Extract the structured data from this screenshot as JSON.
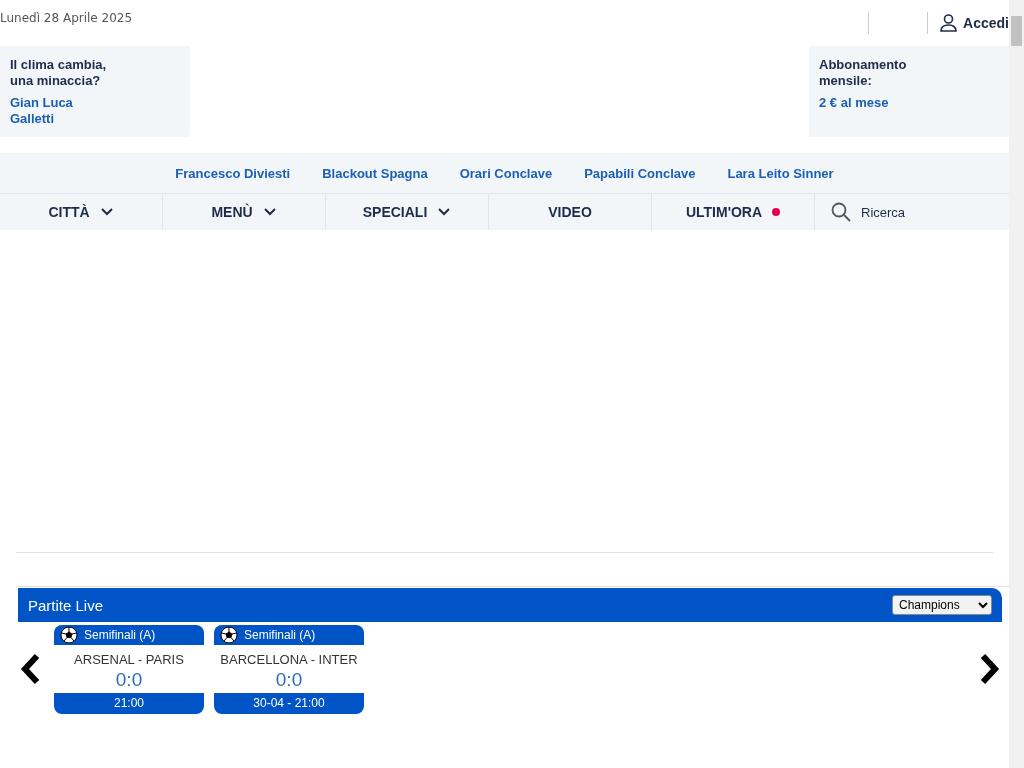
{
  "header": {
    "date": "Lunedì 28 Aprile 2025",
    "login": "Accedi"
  },
  "promo_left": {
    "title": "Il clima cambia, una minaccia?",
    "author": "Gian Luca Galletti"
  },
  "promo_right": {
    "title": "Abbonamento mensile:",
    "price": "2 € al mese"
  },
  "trending": [
    "Francesco Diviesti",
    "Blackout Spagna",
    "Orari Conclave",
    "Papabili Conclave",
    "Lara Leito Sinner"
  ],
  "nav": [
    {
      "label": "CITTÀ",
      "kind": "dropdown"
    },
    {
      "label": "MENÙ",
      "kind": "dropdown"
    },
    {
      "label": "SPECIALI",
      "kind": "dropdown"
    },
    {
      "label": "VIDEO",
      "kind": "link"
    },
    {
      "label": "ULTIM'ORA",
      "kind": "live"
    }
  ],
  "search": {
    "placeholder": "Ricerca"
  },
  "live_widget": {
    "title": "Partite Live",
    "competition": "Champions",
    "matches": [
      {
        "round": "Semifinali (A)",
        "teams": "ARSENAL - PARIS",
        "score": "0:0",
        "time": "21:00"
      },
      {
        "round": "Semifinali (A)",
        "teams": "BARCELLONA - INTER",
        "score": "0:0",
        "time": "30-04 - 21:00"
      }
    ]
  }
}
